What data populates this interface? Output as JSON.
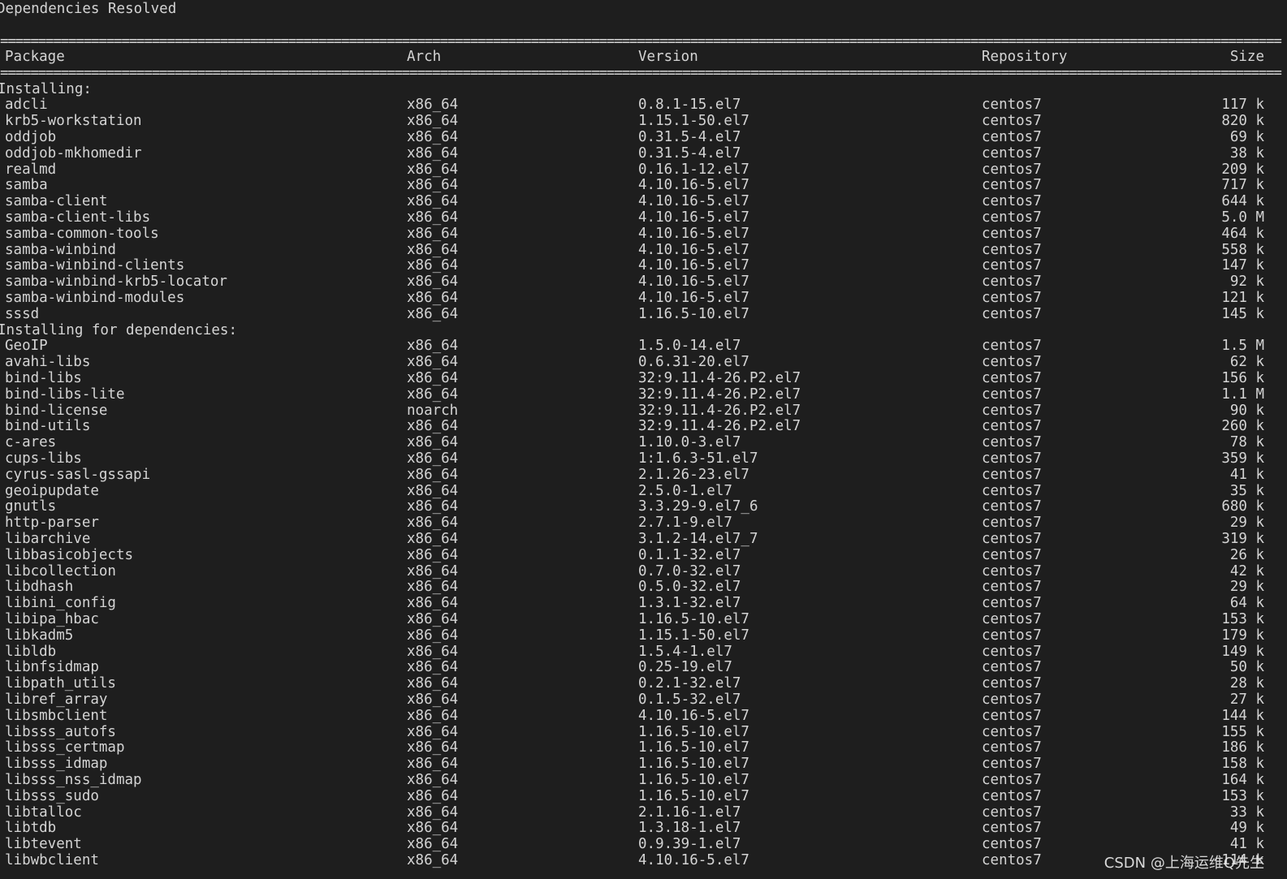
{
  "title": "Dependencies Resolved",
  "separator": "=========================================================================================================================================================================",
  "headers": {
    "package": "Package",
    "arch": "Arch",
    "version": "Version",
    "repository": "Repository",
    "size": "Size"
  },
  "sections": [
    {
      "label": "Installing:",
      "rows": [
        {
          "package": "adcli",
          "arch": "x86_64",
          "version": "0.8.1-15.el7",
          "repository": "centos7",
          "size": "117 k"
        },
        {
          "package": "krb5-workstation",
          "arch": "x86_64",
          "version": "1.15.1-50.el7",
          "repository": "centos7",
          "size": "820 k"
        },
        {
          "package": "oddjob",
          "arch": "x86_64",
          "version": "0.31.5-4.el7",
          "repository": "centos7",
          "size": "69 k"
        },
        {
          "package": "oddjob-mkhomedir",
          "arch": "x86_64",
          "version": "0.31.5-4.el7",
          "repository": "centos7",
          "size": "38 k"
        },
        {
          "package": "realmd",
          "arch": "x86_64",
          "version": "0.16.1-12.el7",
          "repository": "centos7",
          "size": "209 k"
        },
        {
          "package": "samba",
          "arch": "x86_64",
          "version": "4.10.16-5.el7",
          "repository": "centos7",
          "size": "717 k"
        },
        {
          "package": "samba-client",
          "arch": "x86_64",
          "version": "4.10.16-5.el7",
          "repository": "centos7",
          "size": "644 k"
        },
        {
          "package": "samba-client-libs",
          "arch": "x86_64",
          "version": "4.10.16-5.el7",
          "repository": "centos7",
          "size": "5.0 M"
        },
        {
          "package": "samba-common-tools",
          "arch": "x86_64",
          "version": "4.10.16-5.el7",
          "repository": "centos7",
          "size": "464 k"
        },
        {
          "package": "samba-winbind",
          "arch": "x86_64",
          "version": "4.10.16-5.el7",
          "repository": "centos7",
          "size": "558 k"
        },
        {
          "package": "samba-winbind-clients",
          "arch": "x86_64",
          "version": "4.10.16-5.el7",
          "repository": "centos7",
          "size": "147 k"
        },
        {
          "package": "samba-winbind-krb5-locator",
          "arch": "x86_64",
          "version": "4.10.16-5.el7",
          "repository": "centos7",
          "size": "92 k"
        },
        {
          "package": "samba-winbind-modules",
          "arch": "x86_64",
          "version": "4.10.16-5.el7",
          "repository": "centos7",
          "size": "121 k"
        },
        {
          "package": "sssd",
          "arch": "x86_64",
          "version": "1.16.5-10.el7",
          "repository": "centos7",
          "size": "145 k"
        }
      ]
    },
    {
      "label": "Installing for dependencies:",
      "rows": [
        {
          "package": "GeoIP",
          "arch": "x86_64",
          "version": "1.5.0-14.el7",
          "repository": "centos7",
          "size": "1.5 M"
        },
        {
          "package": "avahi-libs",
          "arch": "x86_64",
          "version": "0.6.31-20.el7",
          "repository": "centos7",
          "size": "62 k"
        },
        {
          "package": "bind-libs",
          "arch": "x86_64",
          "version": "32:9.11.4-26.P2.el7",
          "repository": "centos7",
          "size": "156 k"
        },
        {
          "package": "bind-libs-lite",
          "arch": "x86_64",
          "version": "32:9.11.4-26.P2.el7",
          "repository": "centos7",
          "size": "1.1 M"
        },
        {
          "package": "bind-license",
          "arch": "noarch",
          "version": "32:9.11.4-26.P2.el7",
          "repository": "centos7",
          "size": "90 k"
        },
        {
          "package": "bind-utils",
          "arch": "x86_64",
          "version": "32:9.11.4-26.P2.el7",
          "repository": "centos7",
          "size": "260 k"
        },
        {
          "package": "c-ares",
          "arch": "x86_64",
          "version": "1.10.0-3.el7",
          "repository": "centos7",
          "size": "78 k"
        },
        {
          "package": "cups-libs",
          "arch": "x86_64",
          "version": "1:1.6.3-51.el7",
          "repository": "centos7",
          "size": "359 k"
        },
        {
          "package": "cyrus-sasl-gssapi",
          "arch": "x86_64",
          "version": "2.1.26-23.el7",
          "repository": "centos7",
          "size": "41 k"
        },
        {
          "package": "geoipupdate",
          "arch": "x86_64",
          "version": "2.5.0-1.el7",
          "repository": "centos7",
          "size": "35 k"
        },
        {
          "package": "gnutls",
          "arch": "x86_64",
          "version": "3.3.29-9.el7_6",
          "repository": "centos7",
          "size": "680 k"
        },
        {
          "package": "http-parser",
          "arch": "x86_64",
          "version": "2.7.1-9.el7",
          "repository": "centos7",
          "size": "29 k"
        },
        {
          "package": "libarchive",
          "arch": "x86_64",
          "version": "3.1.2-14.el7_7",
          "repository": "centos7",
          "size": "319 k"
        },
        {
          "package": "libbasicobjects",
          "arch": "x86_64",
          "version": "0.1.1-32.el7",
          "repository": "centos7",
          "size": "26 k"
        },
        {
          "package": "libcollection",
          "arch": "x86_64",
          "version": "0.7.0-32.el7",
          "repository": "centos7",
          "size": "42 k"
        },
        {
          "package": "libdhash",
          "arch": "x86_64",
          "version": "0.5.0-32.el7",
          "repository": "centos7",
          "size": "29 k"
        },
        {
          "package": "libini_config",
          "arch": "x86_64",
          "version": "1.3.1-32.el7",
          "repository": "centos7",
          "size": "64 k"
        },
        {
          "package": "libipa_hbac",
          "arch": "x86_64",
          "version": "1.16.5-10.el7",
          "repository": "centos7",
          "size": "153 k"
        },
        {
          "package": "libkadm5",
          "arch": "x86_64",
          "version": "1.15.1-50.el7",
          "repository": "centos7",
          "size": "179 k"
        },
        {
          "package": "libldb",
          "arch": "x86_64",
          "version": "1.5.4-1.el7",
          "repository": "centos7",
          "size": "149 k"
        },
        {
          "package": "libnfsidmap",
          "arch": "x86_64",
          "version": "0.25-19.el7",
          "repository": "centos7",
          "size": "50 k"
        },
        {
          "package": "libpath_utils",
          "arch": "x86_64",
          "version": "0.2.1-32.el7",
          "repository": "centos7",
          "size": "28 k"
        },
        {
          "package": "libref_array",
          "arch": "x86_64",
          "version": "0.1.5-32.el7",
          "repository": "centos7",
          "size": "27 k"
        },
        {
          "package": "libsmbclient",
          "arch": "x86_64",
          "version": "4.10.16-5.el7",
          "repository": "centos7",
          "size": "144 k"
        },
        {
          "package": "libsss_autofs",
          "arch": "x86_64",
          "version": "1.16.5-10.el7",
          "repository": "centos7",
          "size": "155 k"
        },
        {
          "package": "libsss_certmap",
          "arch": "x86_64",
          "version": "1.16.5-10.el7",
          "repository": "centos7",
          "size": "186 k"
        },
        {
          "package": "libsss_idmap",
          "arch": "x86_64",
          "version": "1.16.5-10.el7",
          "repository": "centos7",
          "size": "158 k"
        },
        {
          "package": "libsss_nss_idmap",
          "arch": "x86_64",
          "version": "1.16.5-10.el7",
          "repository": "centos7",
          "size": "164 k"
        },
        {
          "package": "libsss_sudo",
          "arch": "x86_64",
          "version": "1.16.5-10.el7",
          "repository": "centos7",
          "size": "153 k"
        },
        {
          "package": "libtalloc",
          "arch": "x86_64",
          "version": "2.1.16-1.el7",
          "repository": "centos7",
          "size": "33 k"
        },
        {
          "package": "libtdb",
          "arch": "x86_64",
          "version": "1.3.18-1.el7",
          "repository": "centos7",
          "size": "49 k"
        },
        {
          "package": "libtevent",
          "arch": "x86_64",
          "version": "0.9.39-1.el7",
          "repository": "centos7",
          "size": "41 k"
        },
        {
          "package": "libwbclient",
          "arch": "x86_64",
          "version": "4.10.16-5.el7",
          "repository": "centos7",
          "size": "114 k"
        }
      ]
    }
  ],
  "watermark": "CSDN @上海运维Q先生",
  "colors": {
    "background": "#1e1e1e",
    "text": "#d4d4d4"
  }
}
